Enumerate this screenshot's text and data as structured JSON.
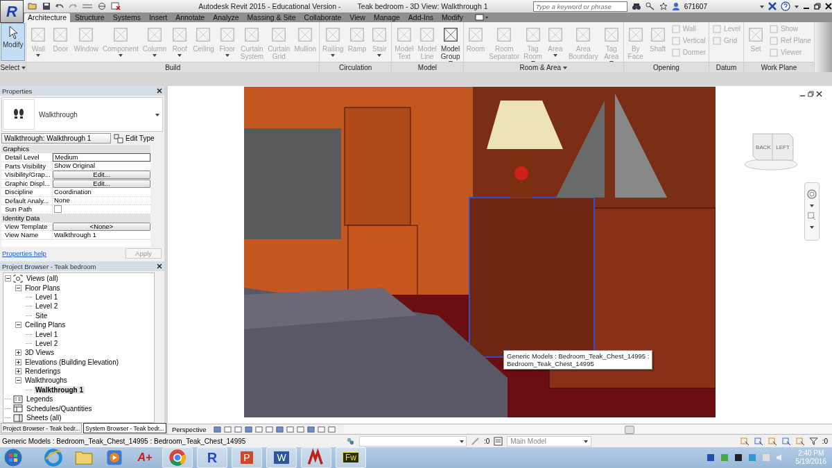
{
  "app_button": {
    "logo": "R"
  },
  "title": [
    "Autodesk Revit 2015 - Educational Version -",
    "Teak bedroom - 3D View: Walkthrough 1"
  ],
  "search": {
    "placeholder": "Type a keyword or phrase"
  },
  "user": "671607",
  "tabs": [
    {
      "label": "Architecture",
      "selected": true
    },
    {
      "label": "Structure",
      "selected": false
    },
    {
      "label": "Systems",
      "selected": false
    },
    {
      "label": "Insert",
      "selected": false
    },
    {
      "label": "Annotate",
      "selected": false
    },
    {
      "label": "Analyze",
      "selected": false
    },
    {
      "label": "Massing & Site",
      "selected": false
    },
    {
      "label": "Collaborate",
      "selected": false
    },
    {
      "label": "View",
      "selected": false
    },
    {
      "label": "Manage",
      "selected": false
    },
    {
      "label": "Add-Ins",
      "selected": false
    },
    {
      "label": "Modify",
      "selected": false
    }
  ],
  "ribbon_panels": [
    {
      "title": "Select",
      "menu": true,
      "items": [
        {
          "kind": "large",
          "lines": [
            "Modify"
          ],
          "disabled": false,
          "selected": true,
          "menu": false
        }
      ]
    },
    {
      "title": "Build",
      "menu": false,
      "items": [
        {
          "kind": "large",
          "lines": [
            "Wall"
          ],
          "disabled": true,
          "selected": false,
          "menu": true
        },
        {
          "kind": "large",
          "lines": [
            "Door"
          ],
          "disabled": true,
          "selected": false,
          "menu": false
        },
        {
          "kind": "large",
          "lines": [
            "Window"
          ],
          "disabled": true,
          "selected": false,
          "menu": false
        },
        {
          "kind": "large",
          "lines": [
            "Component"
          ],
          "disabled": true,
          "selected": false,
          "menu": true
        },
        {
          "kind": "large",
          "lines": [
            "Column"
          ],
          "disabled": true,
          "selected": false,
          "menu": true
        },
        {
          "kind": "large",
          "lines": [
            "Roof"
          ],
          "disabled": true,
          "selected": false,
          "menu": true
        },
        {
          "kind": "large",
          "lines": [
            "Ceiling"
          ],
          "disabled": true,
          "selected": false,
          "menu": false
        },
        {
          "kind": "large",
          "lines": [
            "Floor"
          ],
          "disabled": true,
          "selected": false,
          "menu": true
        },
        {
          "kind": "large",
          "lines": [
            "Curtain",
            "System"
          ],
          "disabled": true,
          "selected": false,
          "menu": false
        },
        {
          "kind": "large",
          "lines": [
            "Curtain",
            "Grid"
          ],
          "disabled": true,
          "selected": false,
          "menu": false
        },
        {
          "kind": "large",
          "lines": [
            "Mullion"
          ],
          "disabled": true,
          "selected": false,
          "menu": false
        }
      ]
    },
    {
      "title": "Circulation",
      "menu": false,
      "items": [
        {
          "kind": "large",
          "lines": [
            "Railing"
          ],
          "disabled": true,
          "selected": false,
          "menu": true
        },
        {
          "kind": "large",
          "lines": [
            "Ramp"
          ],
          "disabled": true,
          "selected": false,
          "menu": false
        },
        {
          "kind": "large",
          "lines": [
            "Stair"
          ],
          "disabled": true,
          "selected": false,
          "menu": true
        }
      ]
    },
    {
      "title": "Model",
      "menu": false,
      "items": [
        {
          "kind": "large",
          "lines": [
            "Model",
            "Text"
          ],
          "disabled": true,
          "selected": false,
          "menu": false
        },
        {
          "kind": "large",
          "lines": [
            "Model",
            "Line"
          ],
          "disabled": true,
          "selected": false,
          "menu": false
        },
        {
          "kind": "large",
          "lines": [
            "Model",
            "Group"
          ],
          "disabled": false,
          "selected": false,
          "menu": true
        }
      ]
    },
    {
      "title": "Room & Area",
      "menu": true,
      "items": [
        {
          "kind": "large",
          "lines": [
            "Room"
          ],
          "disabled": true,
          "selected": false,
          "menu": false
        },
        {
          "kind": "large",
          "lines": [
            "Room",
            "Separator"
          ],
          "disabled": true,
          "selected": false,
          "menu": false
        },
        {
          "kind": "large",
          "lines": [
            "Tag",
            "Room"
          ],
          "disabled": true,
          "selected": false,
          "menu": true
        },
        {
          "kind": "large",
          "lines": [
            "Area"
          ],
          "disabled": true,
          "selected": false,
          "menu": true
        },
        {
          "kind": "large",
          "lines": [
            "Area",
            "Boundary"
          ],
          "disabled": true,
          "selected": false,
          "menu": false
        },
        {
          "kind": "large",
          "lines": [
            "Tag",
            "Area"
          ],
          "disabled": true,
          "selected": false,
          "menu": true
        }
      ]
    },
    {
      "title": "Opening",
      "menu": false,
      "items": [
        {
          "kind": "large",
          "lines": [
            "By",
            "Face"
          ],
          "disabled": true,
          "selected": false,
          "menu": false
        },
        {
          "kind": "large",
          "lines": [
            "Shaft"
          ],
          "disabled": true,
          "selected": false,
          "menu": false
        },
        {
          "kind": "small",
          "lines": [
            "Wall"
          ],
          "disabled": true
        },
        {
          "kind": "small",
          "lines": [
            "Vertical"
          ],
          "disabled": true
        },
        {
          "kind": "small",
          "lines": [
            "Dormer"
          ],
          "disabled": true
        }
      ]
    },
    {
      "title": "Datum",
      "menu": false,
      "items": [
        {
          "kind": "small",
          "lines": [
            "Level"
          ],
          "disabled": true
        },
        {
          "kind": "small",
          "lines": [
            "Grid"
          ],
          "disabled": true
        }
      ]
    },
    {
      "title": "Work Plane",
      "menu": false,
      "items": [
        {
          "kind": "large",
          "lines": [
            "Set"
          ],
          "disabled": true,
          "selected": false,
          "menu": false
        },
        {
          "kind": "small",
          "lines": [
            "Show"
          ],
          "disabled": true
        },
        {
          "kind": "small",
          "lines": [
            "Ref",
            "Plane"
          ],
          "disabled": true
        },
        {
          "kind": "small",
          "lines": [
            "Viewer"
          ],
          "disabled": true
        }
      ]
    }
  ],
  "properties": {
    "title": "Properties",
    "type_name": "Walkthrough",
    "selector": "Walkthrough: Walkthrough 1",
    "edit_type": "Edit Type",
    "groups": [
      {
        "name": "Graphics",
        "rows": [
          {
            "label": "Detail Level",
            "kind": "text",
            "value": "Medium"
          },
          {
            "label": "Parts Visibility",
            "kind": "text",
            "value": "Show Original"
          },
          {
            "label": "Visibility/Grap...",
            "kind": "button",
            "value": "Edit..."
          },
          {
            "label": "Graphic Displ...",
            "kind": "button",
            "value": "Edit..."
          },
          {
            "label": "Discipline",
            "kind": "text",
            "value": "Coordination"
          },
          {
            "label": "Default Analy...",
            "kind": "text",
            "value": "None"
          },
          {
            "label": "Sun Path",
            "kind": "checkbox",
            "checked": false
          }
        ]
      },
      {
        "name": "Identity Data",
        "rows": [
          {
            "label": "View Template",
            "kind": "button",
            "value": "<None>"
          },
          {
            "label": "View Name",
            "kind": "text",
            "value": "Walkthrough 1"
          }
        ]
      }
    ],
    "help": "Properties help",
    "apply": "Apply"
  },
  "project_browser": {
    "title": "Project Browser - Teak bedroom",
    "tree": [
      {
        "label": "Views (all)",
        "kind": "views",
        "expanded": true,
        "selected": false,
        "children": [
          {
            "label": "Floor Plans",
            "expanded": true,
            "selected": false,
            "children": [
              {
                "label": "Level 1",
                "selected": false
              },
              {
                "label": "Level 2",
                "selected": false
              },
              {
                "label": "Site",
                "selected": false
              }
            ]
          },
          {
            "label": "Ceiling Plans",
            "expanded": true,
            "selected": false,
            "children": [
              {
                "label": "Level 1",
                "selected": false
              },
              {
                "label": "Level 2",
                "selected": false
              }
            ]
          },
          {
            "label": "3D Views",
            "expanded": false,
            "selected": false
          },
          {
            "label": "Elevations (Building Elevation)",
            "expanded": false,
            "selected": false
          },
          {
            "label": "Renderings",
            "expanded": false,
            "selected": false
          },
          {
            "label": "Walkthroughs",
            "expanded": true,
            "selected": false,
            "children": [
              {
                "label": "Walkthrough 1",
                "selected": true
              }
            ]
          }
        ]
      },
      {
        "label": "Legends",
        "kind": "legend",
        "selected": false
      },
      {
        "label": "Schedules/Quantities",
        "kind": "schedule",
        "selected": false
      },
      {
        "label": "Sheets (all)",
        "kind": "sheet",
        "selected": false
      }
    ]
  },
  "panel_tabs": [
    {
      "label": "Project Browser - Teak bedr...",
      "selected": false
    },
    {
      "label": "System Browser - Teak bedr...",
      "selected": true
    }
  ],
  "view_cube": [
    "BACK",
    "LEFT"
  ],
  "tooltip": [
    "Generic Models : Bedroom_Teak_Chest_14995 :",
    "Bedroom_Teak_Chest_14995"
  ],
  "view_bar": {
    "label": "Perspective"
  },
  "status_bar": {
    "text": "Generic Models : Bedroom_Teak_Chest_14995 : Bedroom_Teak_Chest_14995",
    "count": ":0",
    "model": "Main Model",
    "filter_count": ":0"
  },
  "taskbar": [
    {
      "kind": "browser"
    },
    {
      "kind": "folder"
    },
    {
      "kind": "media"
    },
    {
      "kind": "letter",
      "label": "A+"
    },
    {
      "kind": "chrome"
    },
    {
      "kind": "logo",
      "label": "R"
    },
    {
      "kind": "office",
      "label": "P",
      "color": "#d24726"
    },
    {
      "kind": "office",
      "label": "W",
      "color": "#2b579a"
    },
    {
      "kind": "mark"
    },
    {
      "kind": "box",
      "label": "Fw"
    }
  ],
  "clock": {
    "time": "2:40 PM",
    "date": "5/19/2016"
  }
}
